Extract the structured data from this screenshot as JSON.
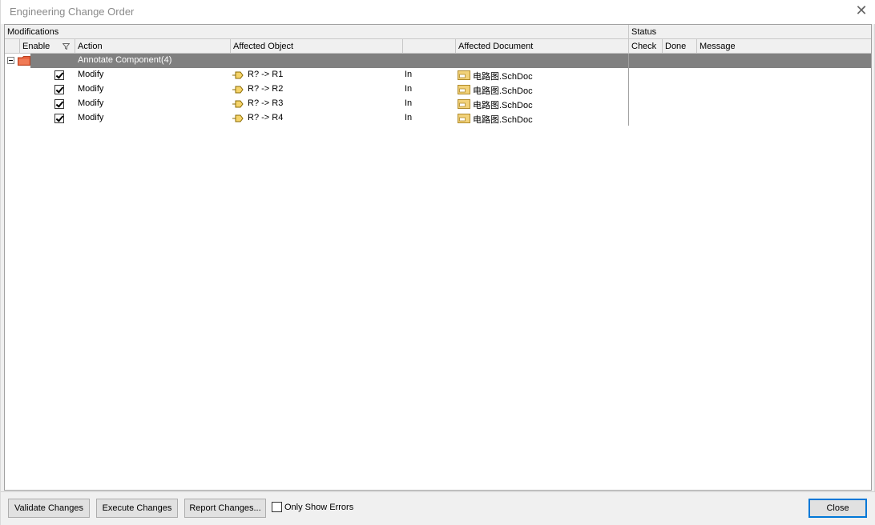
{
  "window": {
    "title": "Engineering Change Order"
  },
  "group_headers": {
    "modifications": "Modifications",
    "status": "Status"
  },
  "columns": {
    "enable": "Enable",
    "action": "Action",
    "affected_object": "Affected Object",
    "affected_document": "Affected Document",
    "check": "Check",
    "done": "Done",
    "message": "Message"
  },
  "group": {
    "label": "Annotate Component(4)",
    "expanded": true
  },
  "rows": [
    {
      "enabled": true,
      "action": "Modify",
      "object": "R? -> R1",
      "direction": "In",
      "document": "电路图.SchDoc"
    },
    {
      "enabled": true,
      "action": "Modify",
      "object": "R? -> R2",
      "direction": "In",
      "document": "电路图.SchDoc"
    },
    {
      "enabled": true,
      "action": "Modify",
      "object": "R? -> R3",
      "direction": "In",
      "document": "电路图.SchDoc"
    },
    {
      "enabled": true,
      "action": "Modify",
      "object": "R? -> R4",
      "direction": "In",
      "document": "电路图.SchDoc"
    }
  ],
  "buttons": {
    "validate": "Validate Changes",
    "execute": "Execute Changes",
    "report": "Report Changes...",
    "close": "Close"
  },
  "options": {
    "only_show_errors": "Only Show Errors",
    "only_show_errors_checked": false
  },
  "icons": {
    "close": "close-icon",
    "folder": "folder-icon",
    "component": "component-icon",
    "document": "document-icon",
    "filter": "filter-icon"
  },
  "colors": {
    "group_bar": "#808080",
    "primary_border": "#0078d7",
    "folder": "#e8603c",
    "document": "#f2d27a"
  }
}
